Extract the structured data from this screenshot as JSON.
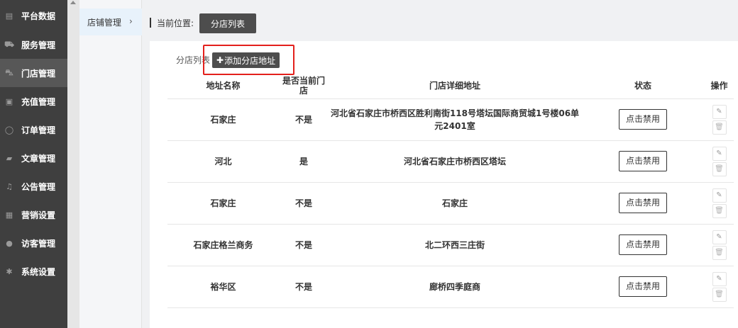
{
  "sidebar": {
    "items": [
      {
        "label": "平台数据",
        "icon": "dashboard-icon",
        "glyph": "▤"
      },
      {
        "label": "服务管理",
        "icon": "cart-icon",
        "glyph": "⛟"
      },
      {
        "label": "门店管理",
        "icon": "car-icon",
        "glyph": "⛍"
      },
      {
        "label": "充值管理",
        "icon": "money-icon",
        "glyph": "▣"
      },
      {
        "label": "订单管理",
        "icon": "comment-icon",
        "glyph": "◯"
      },
      {
        "label": "文章管理",
        "icon": "book-icon",
        "glyph": "▰"
      },
      {
        "label": "公告管理",
        "icon": "bell-icon",
        "glyph": "♫"
      },
      {
        "label": "营销设置",
        "icon": "gift-icon",
        "glyph": "▦"
      },
      {
        "label": "访客管理",
        "icon": "user-icon",
        "glyph": "●"
      },
      {
        "label": "系统设置",
        "icon": "gear-icon",
        "glyph": "✱"
      }
    ],
    "active_index": 2
  },
  "submenu": {
    "label": "店铺管理",
    "chevron": "›"
  },
  "breadcrumb": {
    "label": "当前位置:",
    "current": "分店列表"
  },
  "panel": {
    "title": "分店列表",
    "add_label": "添加分店地址",
    "add_plus": "✚"
  },
  "table": {
    "headers": {
      "name": "地址名称",
      "current": "是否当前门店",
      "address": "门店详细地址",
      "state": "状态",
      "op": "操作"
    },
    "rows": [
      {
        "name": "石家庄",
        "current": "不是",
        "address": "河北省石家庄市桥西区胜利南街118号塔坛国际商贸城1号楼06单元2401室",
        "state": "点击禁用"
      },
      {
        "name": "河北",
        "current": "是",
        "address": "河北省石家庄市桥西区塔坛",
        "state": "点击禁用"
      },
      {
        "name": "石家庄",
        "current": "不是",
        "address": "石家庄",
        "state": "点击禁用"
      },
      {
        "name": "石家庄格兰商务",
        "current": "不是",
        "address": "北二环西三庄街",
        "state": "点击禁用"
      },
      {
        "name": "裕华区",
        "current": "不是",
        "address": "廊桥四季庭商",
        "state": "点击禁用"
      }
    ],
    "edit_glyph": "✎",
    "delete_glyph": "🗑"
  },
  "colors": {
    "sidebar_bg": "#3f3f3f",
    "accent_btn": "#4d4d4d",
    "highlight": "#e3201c"
  }
}
